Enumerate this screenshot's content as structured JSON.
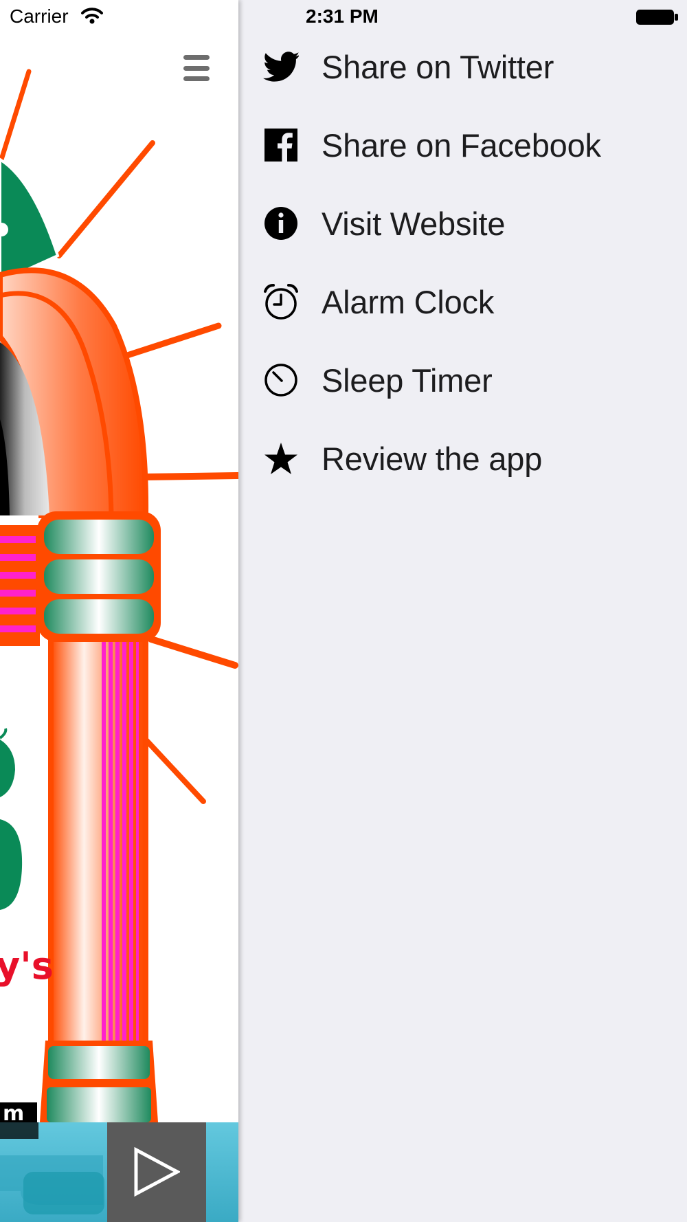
{
  "status_bar": {
    "carrier": "Carrier",
    "time": "2:31 PM",
    "wifi_icon": "wifi-icon",
    "battery_icon": "battery-icon"
  },
  "app": {
    "menu_button_icon": "hamburger-icon",
    "artwork_icon": "jukebox-artwork",
    "artwork_visible_text": "y's",
    "player": {
      "play_icon": "play-icon"
    },
    "colors": {
      "accent_orange": "#ff4a00",
      "accent_green": "#0a8a57",
      "accent_pink": "#ff22cc",
      "player_bar": "#4fbfd6",
      "play_button_bg": "#5a5a5a"
    }
  },
  "menu": {
    "background": "#efeff4",
    "items": [
      {
        "label": "Share on Twitter",
        "icon": "twitter-icon"
      },
      {
        "label": "Share on Facebook",
        "icon": "facebook-icon"
      },
      {
        "label": "Visit Website",
        "icon": "info-icon"
      },
      {
        "label": "Alarm Clock",
        "icon": "alarm-clock-icon"
      },
      {
        "label": "Sleep Timer",
        "icon": "clock-icon"
      },
      {
        "label": "Review the app",
        "icon": "star-icon"
      }
    ]
  }
}
